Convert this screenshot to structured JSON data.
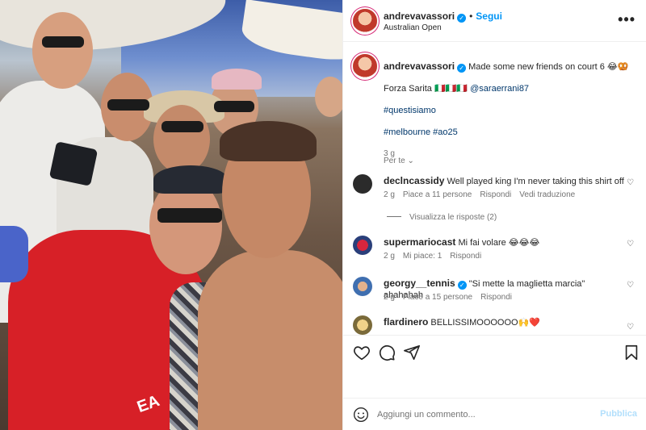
{
  "post": {
    "username": "andrevavassori",
    "follow_label": "Segui",
    "separator": "•",
    "location": "Australian Open",
    "more_label": "•••"
  },
  "caption": {
    "username": "andrevavassori",
    "text": "Made some new friends on court 6 😂🥨",
    "line2_prefix": "Forza Sarita 🇮🇹🇮🇹🇮🇹",
    "line2_mention": "@saraerrani87",
    "hashtag1": "#questisiamo",
    "hashtags2": "#melbourne #ao25",
    "time": "3 g",
    "see_translation": "Per te"
  },
  "comments": [
    {
      "username": "declncassidy",
      "text": "Well played king I'm never taking this shirt off",
      "time": "2 g",
      "likes": "Piace a 11 persone",
      "reply": "Rispondi",
      "translate": "Vedi traduzione",
      "view_replies": "Visualizza le risposte (2)"
    },
    {
      "username": "supermariocast",
      "text": "Mi fai volare 😂😂😂",
      "time": "2 g",
      "likes": "Mi piace: 1",
      "reply": "Rispondi"
    },
    {
      "username": "georgy__tennis",
      "text": "\"Si mette la maglietta marcia\" ahahahah",
      "time": "2 g",
      "likes": "Piace a 15 persone",
      "reply": "Rispondi"
    },
    {
      "username": "flardinero",
      "text": "BELLISSIMOOOOOO🙌❤️"
    }
  ],
  "add_comment": {
    "placeholder": "Aggiungi un commento...",
    "publish_label": "Pubblica"
  },
  "photo": {
    "shirt_logo": "EA"
  },
  "colors": {
    "accent": "#0095f6",
    "link": "#00376b",
    "secondary_text": "#737373",
    "border": "#efefef",
    "publish_disabled": "#b2dffc"
  }
}
